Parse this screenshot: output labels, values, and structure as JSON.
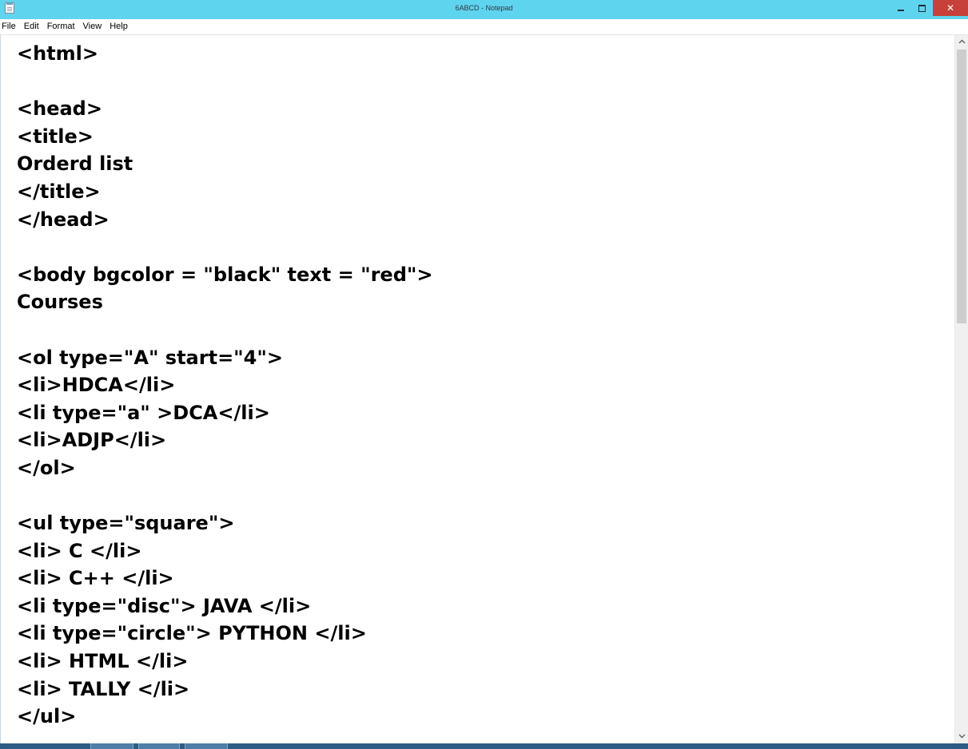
{
  "window": {
    "title": "6ABCD - Notepad",
    "titlebar_color": "#5fd4ef",
    "close_color": "#c7403a",
    "icon": "notepad-icon"
  },
  "controls": {
    "minimize_icon": "minimize-icon",
    "restore_icon": "restore-icon",
    "close_label": "✕"
  },
  "menu": [
    "File",
    "Edit",
    "Format",
    "View",
    "Help"
  ],
  "editor": {
    "lines": [
      "<html>",
      "",
      "<head>",
      "<title>",
      "Orderd list",
      "</title>",
      "</head>",
      "",
      "<body bgcolor = \"black\" text = \"red\">",
      "Courses",
      "",
      "<ol type=\"A\" start=\"4\">",
      "<li>HDCA</li>",
      "<li type=\"a\" >DCA</li>",
      "<li>ADJP</li>",
      "</ol>",
      "",
      "<ul type=\"square\">",
      "<li> C </li>",
      "<li> C++ </li>",
      "<li type=\"disc\"> JAVA </li>",
      "<li type=\"circle\"> PYTHON </li>",
      "<li> HTML </li>",
      "<li> TALLY </li>",
      "</ul>"
    ]
  },
  "scrollbar": {
    "up_arrow": "^",
    "down_arrow": "v",
    "scroll_position": 0.0
  }
}
